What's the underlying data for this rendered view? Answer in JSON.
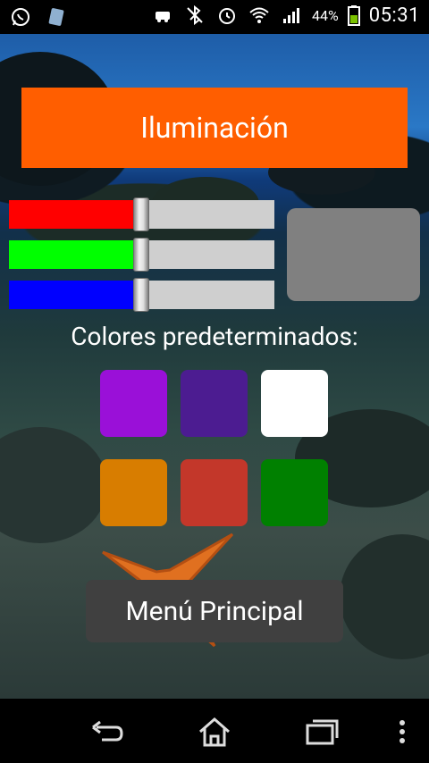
{
  "status_bar": {
    "battery_percent": "44%",
    "time": "05:31"
  },
  "title": "Iluminación",
  "sliders": [
    {
      "name": "red",
      "color": "#ff0000",
      "value_fraction": 0.5
    },
    {
      "name": "green",
      "color": "#00ff00",
      "value_fraction": 0.5
    },
    {
      "name": "blue",
      "color": "#0000ff",
      "value_fraction": 0.5
    }
  ],
  "preview_color": "#808080",
  "preset_label": "Colores predeterminados:",
  "presets": [
    {
      "name": "purple",
      "color": "#9a10d8"
    },
    {
      "name": "indigo",
      "color": "#4c1c91"
    },
    {
      "name": "white",
      "color": "#ffffff"
    },
    {
      "name": "orange",
      "color": "#d87d00"
    },
    {
      "name": "red-brown",
      "color": "#c3372a"
    },
    {
      "name": "green",
      "color": "#008000"
    }
  ],
  "menu_button": "Menú Principal",
  "nav": {
    "icons": [
      "back-icon",
      "home-icon",
      "recents-icon",
      "overflow-menu-icon"
    ]
  }
}
